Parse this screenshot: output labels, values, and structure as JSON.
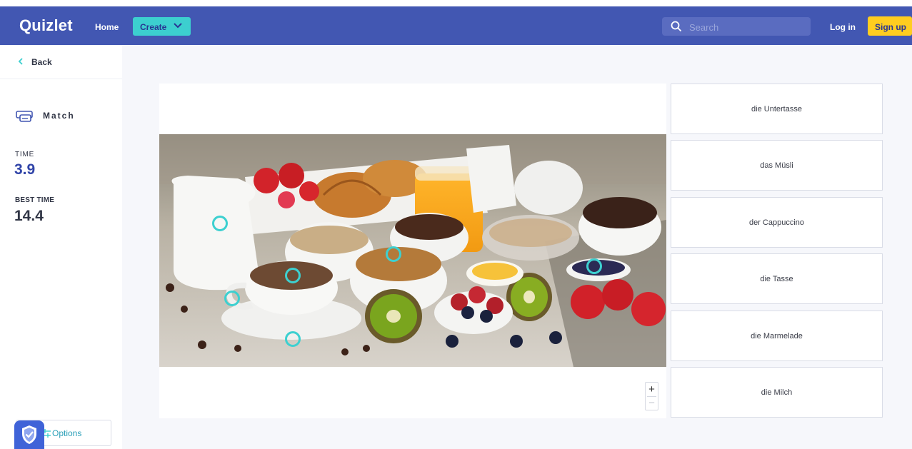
{
  "header": {
    "logo": "Quizlet",
    "home_label": "Home",
    "create_label": "Create",
    "search_placeholder": "Search",
    "login_label": "Log in",
    "signup_label": "Sign up",
    "brand_color": "#4257b2",
    "accent_color": "#3ccfcf",
    "signup_color": "#ffcd1f"
  },
  "sidebar": {
    "back_label": "Back",
    "mode_label": "Match",
    "time_label": "TIME",
    "time_value": "3.9",
    "best_time_label": "BEST TIME",
    "best_time_value": "14.4",
    "options_label": "Options"
  },
  "diagram": {
    "zoom_in": "+",
    "zoom_out": "−",
    "hotspot_color": "#3dd0d0"
  },
  "terms": [
    {
      "label": "die Untertasse"
    },
    {
      "label": "das Müsli"
    },
    {
      "label": "der Cappuccino"
    },
    {
      "label": "die Tasse"
    },
    {
      "label": "die Marmelade"
    },
    {
      "label": "die Milch"
    }
  ]
}
